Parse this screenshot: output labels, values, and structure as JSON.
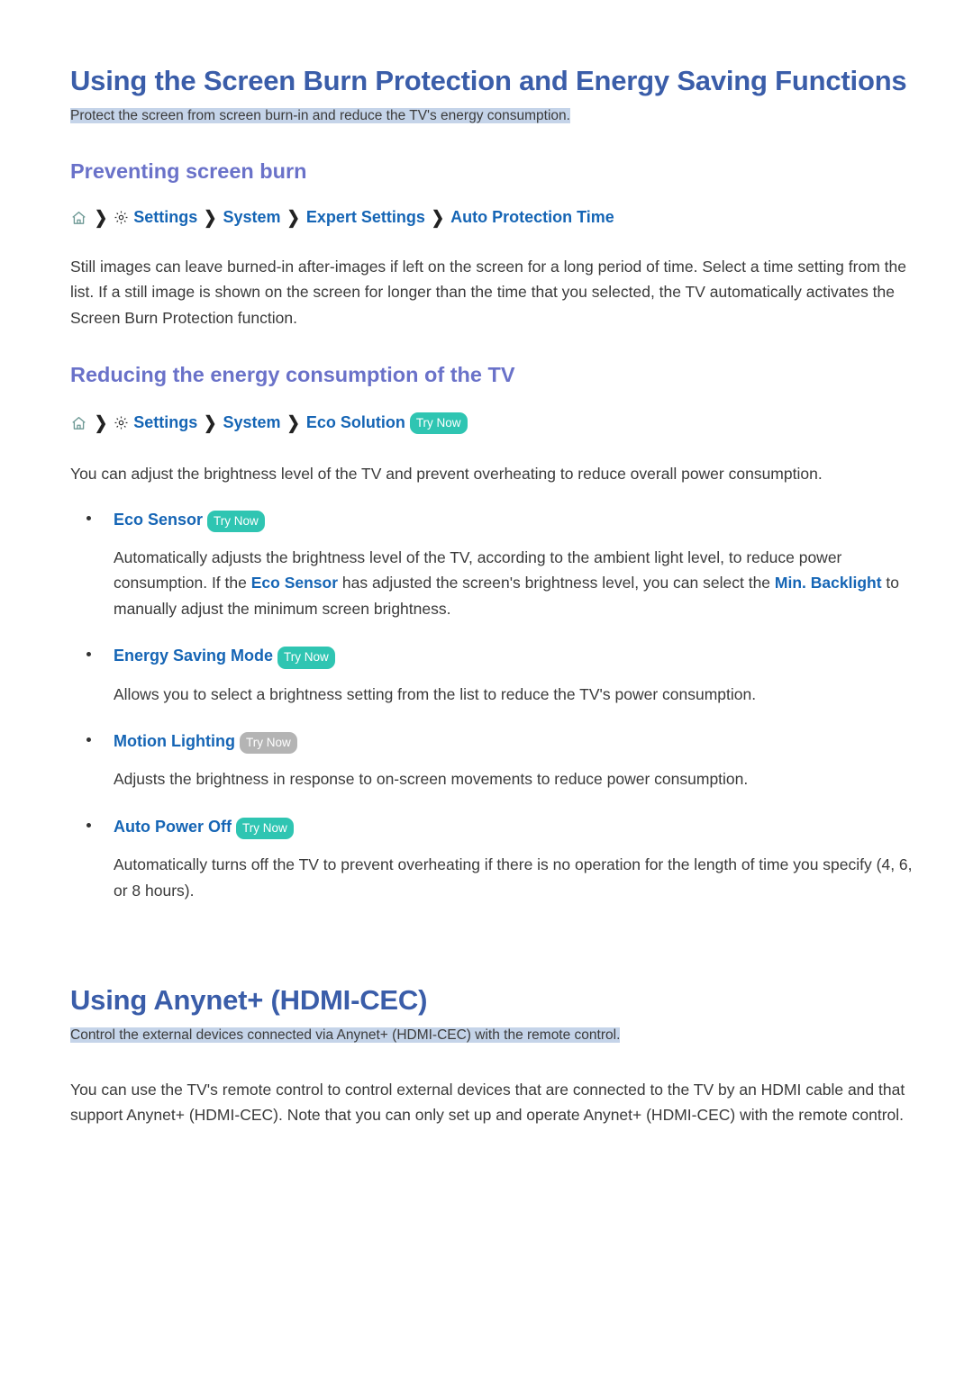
{
  "document": {
    "title": "Using the Screen Burn Protection and Energy Saving Functions",
    "subtitle": "Protect the screen from screen burn-in and reduce the TV's energy consumption."
  },
  "icons": {
    "home": "home-icon",
    "gear": "gear-icon",
    "chevron": "❯"
  },
  "badges": {
    "try_now": "Try Now"
  },
  "sections": [
    {
      "heading": "Preventing screen burn",
      "breadcrumb": [
        "Settings",
        "System",
        "Expert Settings",
        "Auto Protection Time"
      ],
      "paragraph": "Still images can leave burned-in after-images if left on the screen for a long period of time.  Select a time setting from the list. If a still image is shown on the screen for longer than the time that you selected, the TV automatically activates the Screen Burn Protection function."
    },
    {
      "heading": "Reducing the energy consumption of the TV",
      "breadcrumb": [
        "Settings",
        "System",
        "Eco Solution"
      ],
      "paragraph": "You can adjust the brightness level of the TV and prevent overheating to reduce overall power consumption."
    }
  ],
  "eco_items": [
    {
      "label": "Eco Sensor",
      "badge": "Try Now",
      "body_before": "Automatically adjusts the brightness level of the TV, according to the ambient light level, to reduce power consumption. If the ",
      "term_1": "Eco Sensor",
      "body_mid": " has adjusted the screen's brightness level, you can select the ",
      "term_2": "Min. Backlight",
      "body_after": " to manually adjust the minimum screen brightness."
    },
    {
      "label": "Energy Saving Mode",
      "badge": "Try Now",
      "body": "Allows you to select a brightness setting from the list to reduce the TV's power consumption."
    },
    {
      "label": "Motion Lighting",
      "badge": "Try Now",
      "body": "Adjusts the brightness in response to on-screen movements to reduce power consumption."
    },
    {
      "label": "Auto Power Off",
      "badge": "Try Now",
      "body": "Automatically turns off the TV to prevent overheating if there is no operation for the length of time you specify (4, 6, or 8 hours)."
    }
  ],
  "anynet": {
    "title": "Using Anynet+ (HDMI-CEC)",
    "subtitle": "Control the external devices connected via Anynet+ (HDMI-CEC) with the remote control.",
    "paragraph": "You can use the TV's remote control to control external devices that are connected to the TV by an HDMI cable and that support Anynet+ (HDMI-CEC). Note that you can only set up and operate Anynet+ (HDMI-CEC) with the remote control."
  },
  "colors": {
    "title_blue": "#3a5da9",
    "heading_purple": "#6a72c9",
    "link_blue": "#1565b5",
    "badge_teal": "#2fc5b2",
    "badge_gray": "#b4b4b4",
    "highlight": "#c5d4e9",
    "body_text": "#3a3a3a"
  }
}
